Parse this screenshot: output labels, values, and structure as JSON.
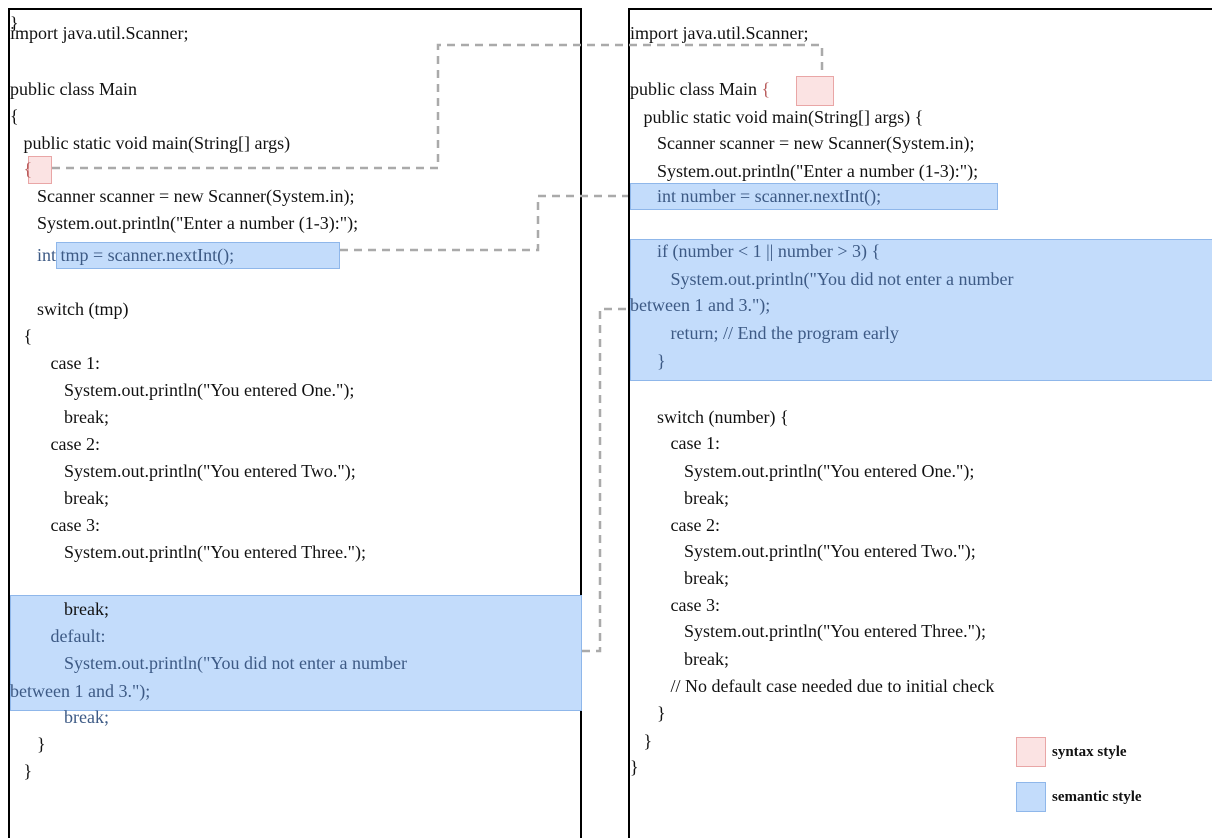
{
  "left": {
    "lines": [
      "import java.util.Scanner;",
      "",
      "public class Main",
      "{",
      "   public static void main(String[] args)",
      "   {",
      "      Scanner scanner = new Scanner(System.in);",
      "      System.out.println(\"Enter a number (1-3):\");",
      "      int tmp = scanner.nextInt();",
      "",
      "      switch (tmp)",
      "   {",
      "         case 1:",
      "            System.out.println(\"You entered One.\");",
      "            break;",
      "         case 2:",
      "            System.out.println(\"You entered Two.\");",
      "            break;",
      "         case 3:",
      "            System.out.println(\"You entered Three.\");",
      "            break;",
      "         default:",
      "            System.out.println(\"You did not enter a number",
      "between 1 and 3.\");",
      "            break;",
      "      }",
      "   }",
      "}"
    ]
  },
  "right": {
    "lines": [
      "import java.util.Scanner;",
      "",
      "public class Main {",
      "   public static void main(String[] args) {",
      "      Scanner scanner = new Scanner(System.in);",
      "      System.out.println(\"Enter a number (1-3):\");",
      "      int number = scanner.nextInt();",
      "",
      "      if (number < 1 || number > 3) {",
      "         System.out.println(\"You did not enter a number",
      "between 1 and 3.\");",
      "         return; // End the program early",
      "      }",
      "",
      "      switch (number) {",
      "         case 1:",
      "            System.out.println(\"You entered One.\");",
      "            break;",
      "         case 2:",
      "            System.out.println(\"You entered Two.\");",
      "            break;",
      "         case 3:",
      "            System.out.println(\"You entered Three.\");",
      "            break;",
      "         // No default case needed due to initial check",
      "      }",
      "   }",
      "}"
    ]
  },
  "legend": {
    "syntax_label": "syntax style",
    "semantic_label": "semantic style",
    "syntax_color": "#fbe3e3",
    "semantic_color": "#c3dcfb"
  }
}
